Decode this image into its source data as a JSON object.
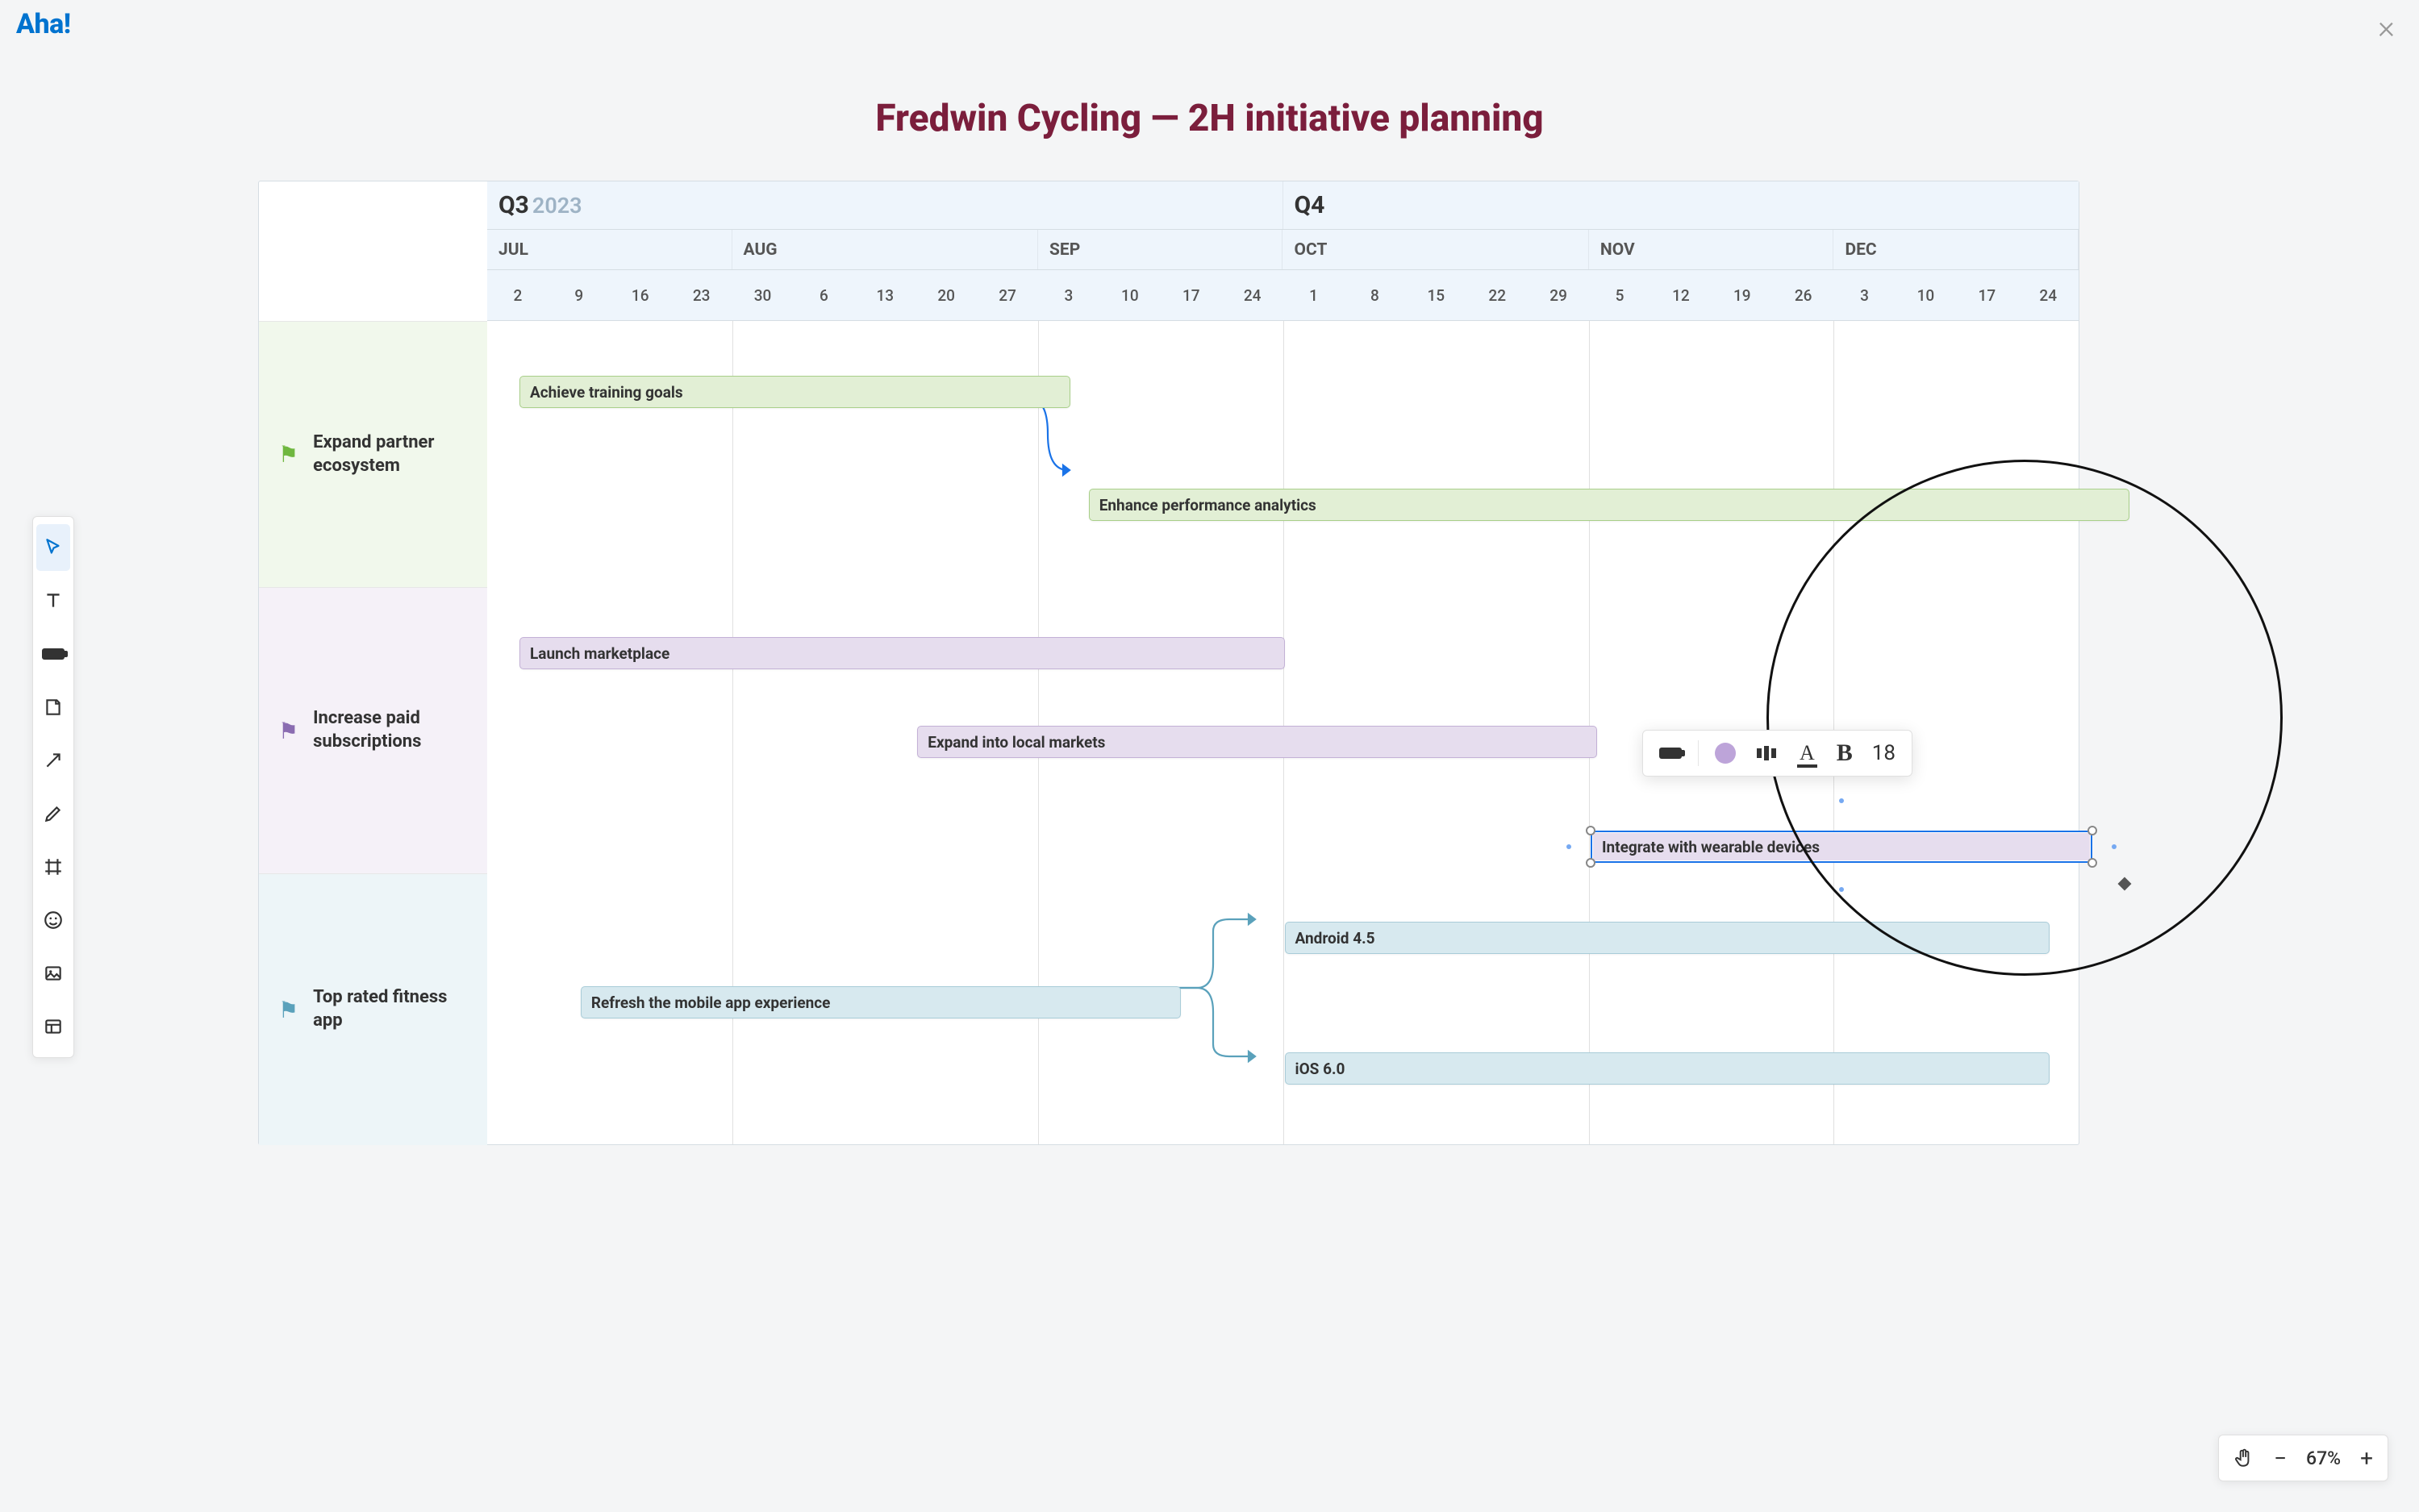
{
  "logo": "Aha!",
  "title": "Fredwin Cycling — 2H initiative planning",
  "quarters": [
    {
      "label": "Q3",
      "year": "2023",
      "width_weeks": 13
    },
    {
      "label": "Q4",
      "year": "",
      "width_weeks": 13
    }
  ],
  "months": [
    {
      "label": "JUL",
      "weeks": 4
    },
    {
      "label": "AUG",
      "weeks": 5
    },
    {
      "label": "SEP",
      "weeks": 4
    },
    {
      "label": "OCT",
      "weeks": 5
    },
    {
      "label": "NOV",
      "weeks": 4
    },
    {
      "label": "DEC",
      "weeks": 4
    }
  ],
  "weeks": [
    "2",
    "9",
    "16",
    "23",
    "30",
    "6",
    "13",
    "20",
    "27",
    "3",
    "10",
    "17",
    "24",
    "1",
    "8",
    "15",
    "22",
    "29",
    "5",
    "12",
    "19",
    "26",
    "3",
    "10",
    "17",
    "24"
  ],
  "lanes": [
    {
      "label": "Expand partner ecosystem",
      "color": "green"
    },
    {
      "label": "Increase paid subscriptions",
      "color": "purple"
    },
    {
      "label": "Top rated fitness app",
      "color": "blue"
    }
  ],
  "bars": [
    {
      "lane": 0,
      "color": "green",
      "label": "Achieve training goals",
      "start_week": 0,
      "span_weeks": 9,
      "row": 0
    },
    {
      "lane": 0,
      "color": "green",
      "label": "Enhance performance analytics",
      "start_week": 9.3,
      "span_weeks": 17,
      "row": 1
    },
    {
      "lane": 1,
      "color": "purple",
      "label": "Launch marketplace",
      "start_week": 0,
      "span_weeks": 12.5,
      "row": 0
    },
    {
      "lane": 1,
      "color": "purple",
      "label": "Expand into local markets",
      "start_week": 6.5,
      "span_weeks": 11.1,
      "row": 1
    },
    {
      "lane": 1,
      "color": "purple",
      "label": "Integrate with wearable devices",
      "start_week": 17.5,
      "span_weeks": 8.2,
      "row": 2,
      "selected": true
    },
    {
      "lane": 2,
      "color": "blue",
      "label": "Refresh the mobile app experience",
      "start_week": 1,
      "span_weeks": 9.8,
      "row": 1
    },
    {
      "lane": 2,
      "color": "blue",
      "label": "Android 4.5",
      "start_week": 12.5,
      "span_weeks": 12.5,
      "row": 0
    },
    {
      "lane": 2,
      "color": "blue",
      "label": "iOS 6.0",
      "start_week": 12.5,
      "span_weeks": 12.5,
      "row": 2
    }
  ],
  "format_bar": {
    "font_size": "18"
  },
  "zoom": {
    "level": "67%"
  }
}
